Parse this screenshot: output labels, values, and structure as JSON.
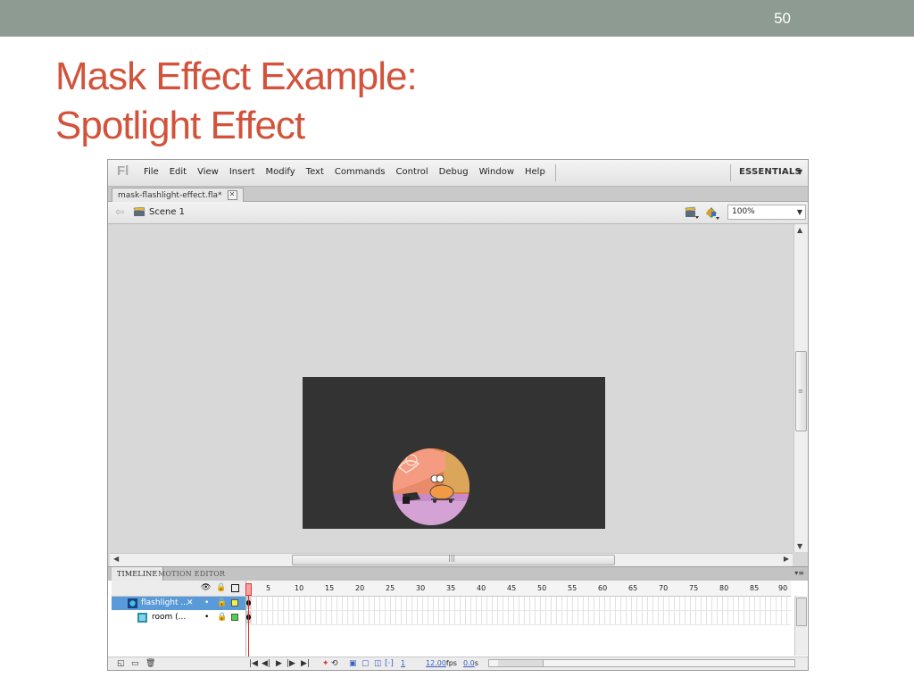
{
  "slide": {
    "number": "50",
    "title_line1": "Mask Effect Example:",
    "title_line2": "Spotlight Effect",
    "title_color": "#d2533c",
    "bar_color": "#8d9b92"
  },
  "app": {
    "logo": "Fl",
    "menu": [
      "File",
      "Edit",
      "View",
      "Insert",
      "Modify",
      "Text",
      "Commands",
      "Control",
      "Debug",
      "Window",
      "Help"
    ],
    "workspace": "ESSENTIALS",
    "document_tab": "mask-flashlight-effect.fla*",
    "scene": "Scene 1",
    "zoom": "100%",
    "stage_color": "#333333"
  },
  "timeline": {
    "tabs": [
      "TIMELINE",
      "MOTION EDITOR"
    ],
    "ruler": [
      "5",
      "10",
      "15",
      "20",
      "25",
      "30",
      "35",
      "40",
      "45",
      "50",
      "55",
      "60",
      "65",
      "70",
      "75",
      "80",
      "85",
      "90"
    ],
    "layers": [
      {
        "name": "flashlight ...",
        "selected": true
      },
      {
        "name": "room (..."
      }
    ],
    "current_frame": "1",
    "fps": "12.00",
    "fps_unit": "fps",
    "time": "0.0",
    "time_unit": "s"
  }
}
